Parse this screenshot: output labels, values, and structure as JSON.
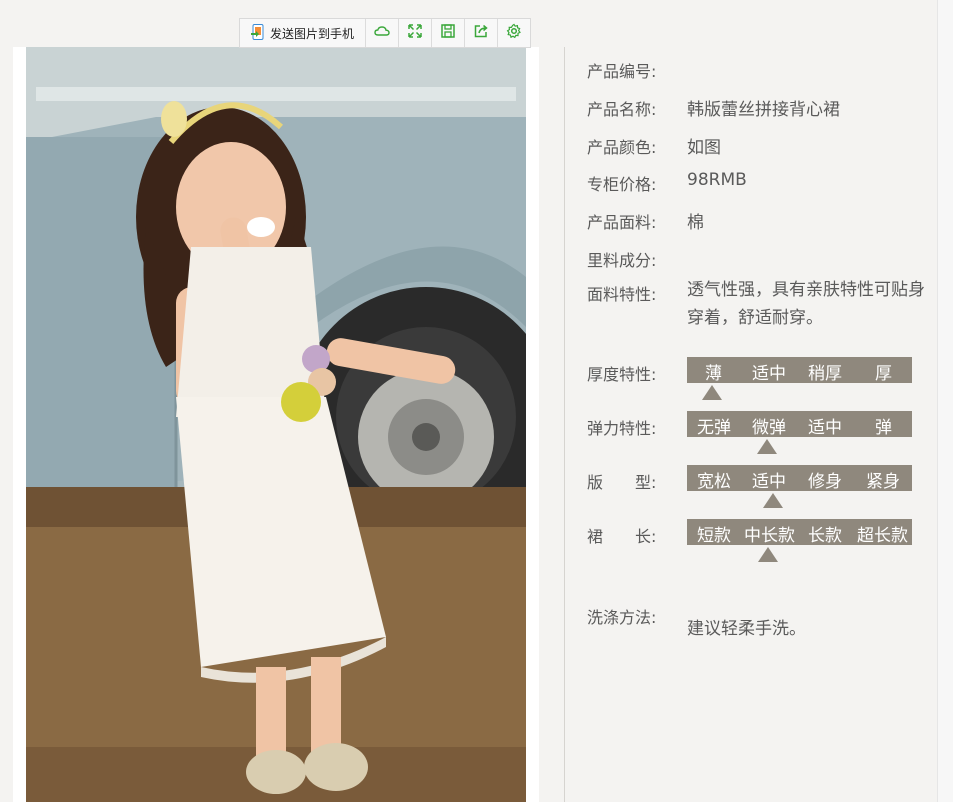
{
  "toolbar": {
    "send_label": "发送图片到手机",
    "icons": [
      "phone-send-icon",
      "cloud-icon",
      "fullscreen-icon",
      "save-icon",
      "share-icon",
      "settings-icon"
    ],
    "accent_color": "#3aa73a"
  },
  "product": {
    "rows": [
      {
        "label": "产品编号:",
        "value": ""
      },
      {
        "label": "产品名称:",
        "value": "韩版蕾丝拼接背心裙"
      },
      {
        "label": "产品颜色:",
        "value": "如图"
      },
      {
        "label": "专柜价格:",
        "value": "98RMB"
      },
      {
        "label": "产品面料:",
        "value": "棉"
      },
      {
        "label": "里料成分:",
        "value": ""
      },
      {
        "label": "面料特性:",
        "value": "透气性强，具有亲肤特性可贴身穿着，舒适耐穿。"
      }
    ],
    "scales": [
      {
        "label": "厚度特性:",
        "options": [
          "薄",
          "适中",
          "稍厚",
          "厚"
        ],
        "selected": "薄"
      },
      {
        "label": "弹力特性:",
        "options": [
          "无弹",
          "微弹",
          "适中",
          "弹"
        ],
        "selected": "微弹"
      },
      {
        "label": "版　　型:",
        "options": [
          "宽松",
          "适中",
          "修身",
          "紧身"
        ],
        "selected": "适中"
      },
      {
        "label": "裙　　长:",
        "options": [
          "短款",
          "中长款",
          "长款",
          "超长款"
        ],
        "selected": "中长款"
      }
    ],
    "wash": {
      "label": "洗涤方法:",
      "value": "建议轻柔手洗。"
    }
  },
  "colors": {
    "scale_bar": "#8f887d",
    "background": "#f4f3f1"
  }
}
